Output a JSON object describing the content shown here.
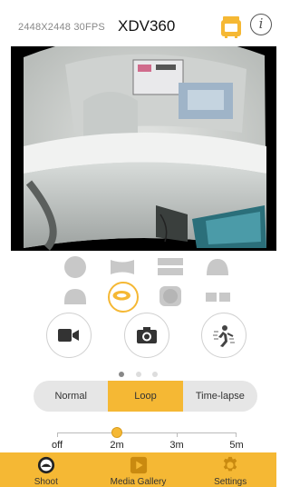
{
  "header": {
    "resolution": "2448X2448 30FPS",
    "title": "XDV360",
    "camera_icon": "camera-status-icon",
    "info_icon": "info-icon",
    "info_glyph": "i"
  },
  "preview": {
    "description": "live 360 fisheye camera preview"
  },
  "view_modes": [
    {
      "name": "sphere-view-icon",
      "selected": false
    },
    {
      "name": "cylinder-view-icon",
      "selected": false
    },
    {
      "name": "split-view-icon",
      "selected": false
    },
    {
      "name": "dome-view-icon",
      "selected": false
    },
    {
      "name": "bowl-view-icon",
      "selected": false
    },
    {
      "name": "ring-view-icon",
      "selected": true
    },
    {
      "name": "rounded-square-view-icon",
      "selected": false
    },
    {
      "name": "dual-panel-view-icon",
      "selected": false
    }
  ],
  "capture_buttons": [
    {
      "name": "video-mode-button",
      "icon": "video-camera-icon"
    },
    {
      "name": "photo-mode-button",
      "icon": "photo-camera-icon"
    },
    {
      "name": "burst-mode-button",
      "icon": "burst-icon"
    }
  ],
  "pager": {
    "count": 3,
    "active": 0
  },
  "record_modes": {
    "normal": "Normal",
    "loop": "Loop",
    "timelapse": "Time-lapse",
    "selected": "Loop"
  },
  "loop_slider": {
    "labels": [
      "off",
      "2m",
      "3m",
      "5m"
    ],
    "value": "2m",
    "fraction": 0.33
  },
  "tabs": [
    {
      "label": "Shoot",
      "icon": "shoot-icon",
      "active": true
    },
    {
      "label": "Media Gallery",
      "icon": "media-gallery-icon",
      "active": false
    },
    {
      "label": "Settings",
      "icon": "settings-gear-icon",
      "active": false
    }
  ],
  "colors": {
    "accent": "#f5b834",
    "tabbar": "#f5b834",
    "text": "#222222"
  }
}
